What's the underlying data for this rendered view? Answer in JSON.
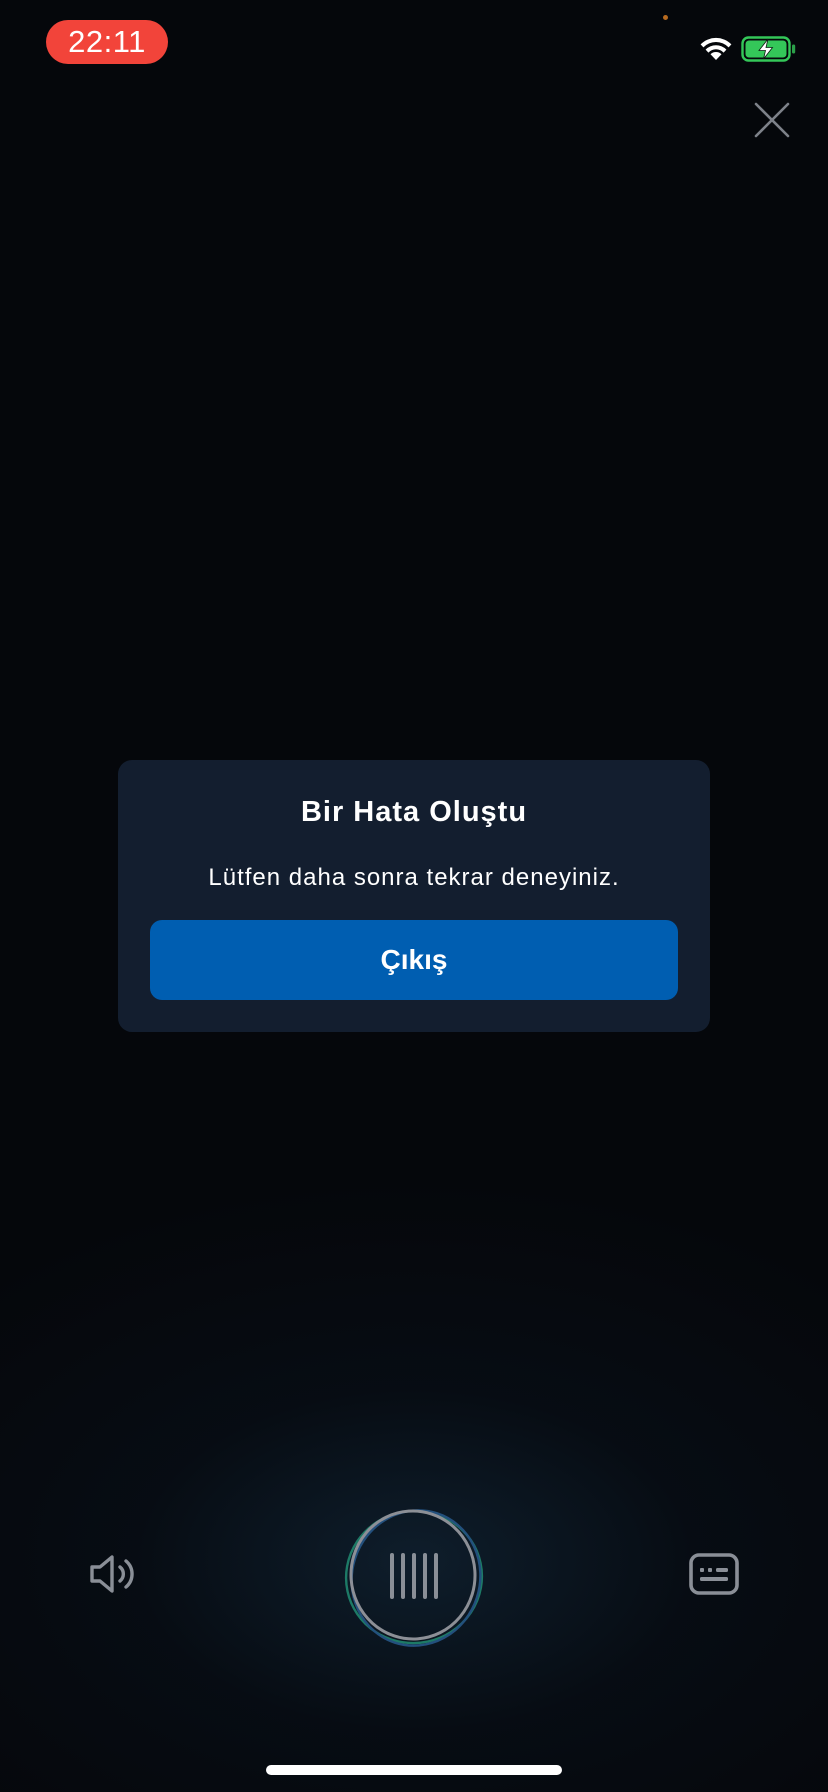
{
  "status_bar": {
    "time": "22:11",
    "time_pill_color": "#f2443a",
    "battery_state": "charging",
    "battery_color": "#34c759",
    "wifi_icon": "wifi-icon"
  },
  "top_bar": {
    "close_icon": "close-icon"
  },
  "dialog": {
    "title": "Bir Hata Oluştu",
    "message": "Lütfen daha sonra tekrar deneyiniz.",
    "button_label": "Çıkış",
    "button_color": "#005eb1",
    "background_color": "#131e2f"
  },
  "controls": {
    "speaker_icon": "speaker-icon",
    "mic_icon": "voice-bars-icon",
    "keyboard_icon": "keyboard-icon"
  }
}
